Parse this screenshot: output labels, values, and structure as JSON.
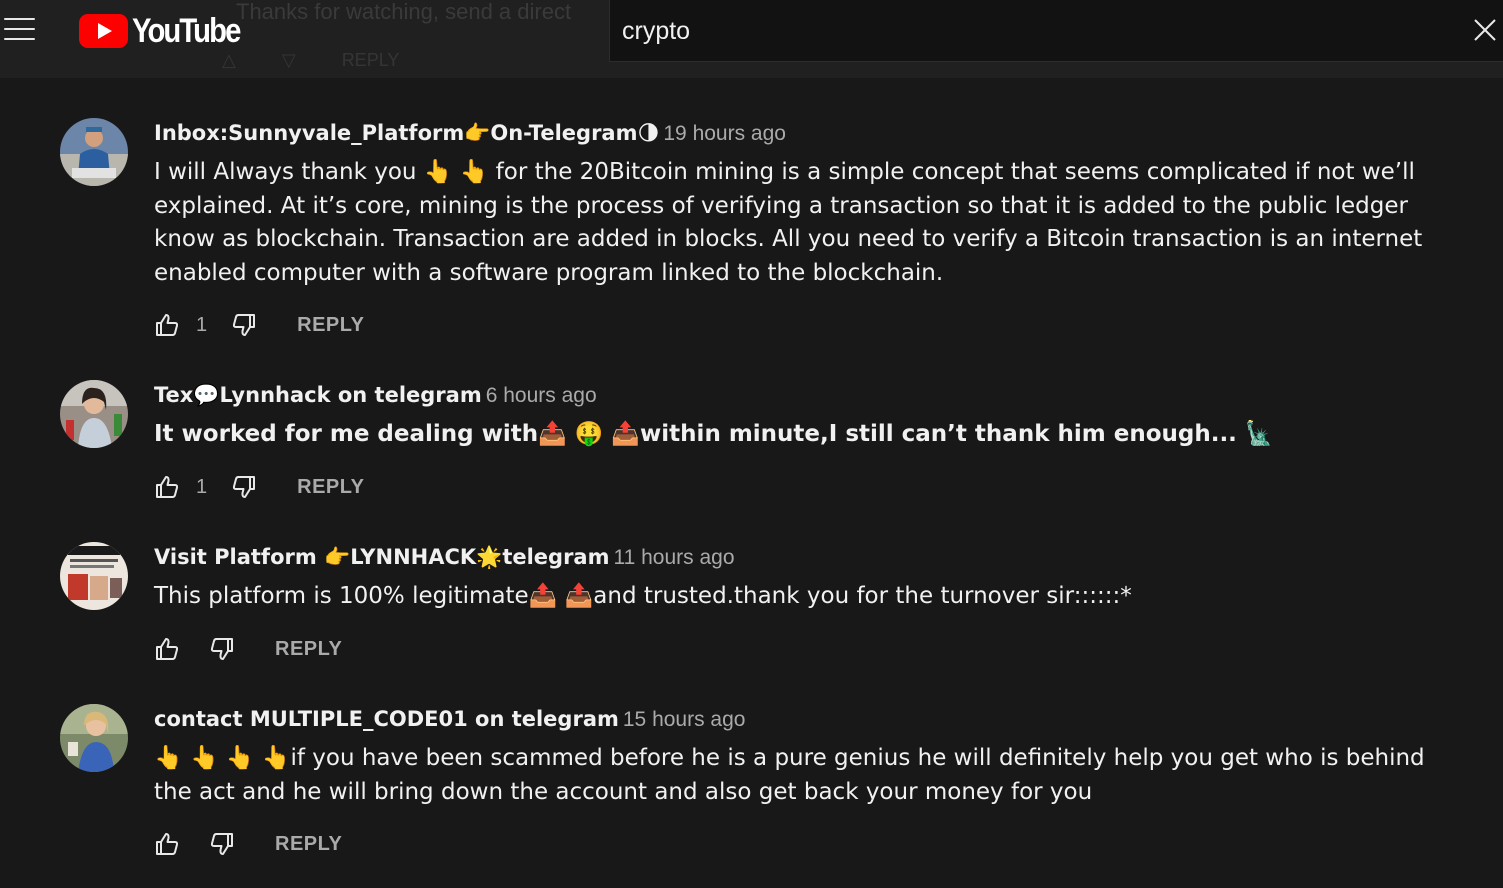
{
  "header": {
    "logo_text": "YouTube",
    "search_value": "crypto",
    "ghost_text": "Thanks for watching, send a direct",
    "ghost_reply": "REPLY"
  },
  "colors": {
    "background": "#181818",
    "header": "#202020",
    "search_bg": "#121212",
    "brand_red": "#ff0000",
    "secondary_text": "#aaaaaa"
  },
  "comments": [
    {
      "author": "Inbox:Sunnyvale_Platform👉On-Telegram🌗",
      "time": "19 hours ago",
      "text": "I will Always thank you 👆 👆 for the 20Bitcoin mining is a simple concept that seems complicated if not we’ll explained. At it’s core, mining is the process of verifying a transaction so that it is added to the public ledger know as blockchain. Transaction are added in blocks. All you need to verify a Bitcoin transaction is an internet enabled computer with a software program linked to the blockchain.",
      "likes": "1",
      "reply": "REPLY"
    },
    {
      "author": "Tex💬Lynnhack on telegram",
      "time": "6 hours ago",
      "text": "It worked for me dealing with📤 🤑 📤within minute,I still can’t thank him enough... 🗽",
      "likes": "1",
      "reply": "REPLY"
    },
    {
      "author": "Visit Platform 👉LYNNHACK🌟telegram",
      "time": "11 hours ago",
      "text": "This platform is 100% legitimate📤 📤and trusted.thank you for the turnover sir::::::*",
      "likes": "",
      "reply": "REPLY"
    },
    {
      "author": "contact MULTIPLE_CODE01 on telegram",
      "time": "15 hours ago",
      "text": "👆 👆 👆 👆if you have been scammed before he is a pure genius he will definitely help you get who is behind the act and he will bring down the account and also get back your money for you",
      "likes": "",
      "reply": "REPLY"
    }
  ],
  "icons": {
    "menu": "hamburger-menu-icon",
    "close": "close-icon",
    "like": "thumbs-up-icon",
    "dislike": "thumbs-down-icon"
  }
}
